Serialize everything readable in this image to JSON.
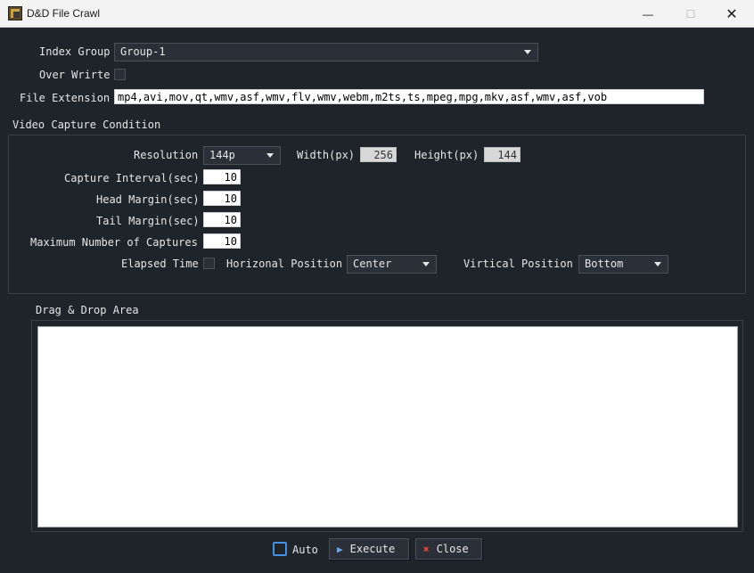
{
  "window": {
    "title": "D&D File Crawl",
    "minimize": "—",
    "maximize": "☐",
    "close": "✕"
  },
  "index_group": {
    "label": "Index Group",
    "value": "Group-1"
  },
  "overwrite": {
    "label": "Over Wrirte",
    "checked": false
  },
  "file_extension": {
    "label": "File Extension",
    "value": "mp4,avi,mov,qt,wmv,asf,wmv,flv,wmv,webm,m2ts,ts,mpeg,mpg,mkv,asf,wmv,asf,vob"
  },
  "video_capture": {
    "section_label": "Video Capture Condition",
    "resolution": {
      "label": "Resolution",
      "value": "144p"
    },
    "width": {
      "label": "Width(px)",
      "value": "256"
    },
    "height": {
      "label": "Height(px)",
      "value": "144"
    },
    "capture_interval": {
      "label": "Capture Interval(sec)",
      "value": "10"
    },
    "head_margin": {
      "label": "Head Margin(sec)",
      "value": "10"
    },
    "tail_margin": {
      "label": "Tail Margin(sec)",
      "value": "10"
    },
    "max_captures": {
      "label": "Maximum Number of Captures",
      "value": "10"
    },
    "elapsed_time": {
      "label": "Elapsed Time",
      "checked": false
    },
    "horizontal_position": {
      "label": "Horizonal Position",
      "value": "Center"
    },
    "vertical_position": {
      "label": "Virtical Position",
      "value": "Bottom"
    }
  },
  "drag_drop": {
    "label": "Drag & Drop Area"
  },
  "footer": {
    "auto_label": "Auto",
    "execute_label": "Execute",
    "close_label": "Close"
  },
  "colors": {
    "background": "#1f232a",
    "titlebar": "#f3f3f3",
    "accent": "#4a90e2",
    "close_icon": "#e04444"
  }
}
